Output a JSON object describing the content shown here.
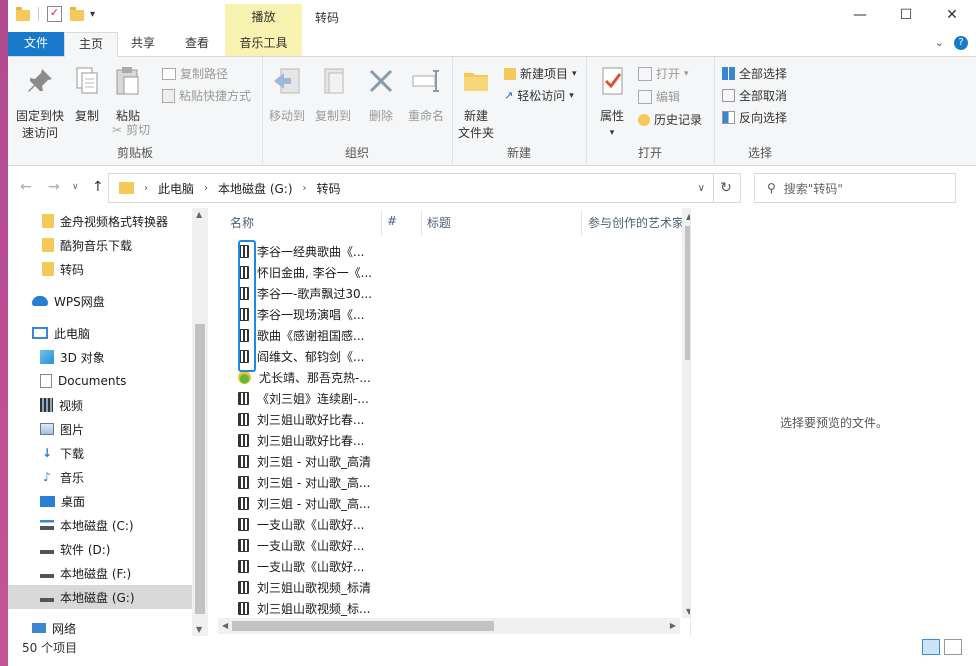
{
  "window": {
    "title": "转码",
    "context_tab": "播放",
    "qat_dropdown": "▾"
  },
  "tabs": [
    {
      "label": "文件"
    },
    {
      "label": "主页"
    },
    {
      "label": "共享"
    },
    {
      "label": "查看"
    },
    {
      "label": "音乐工具"
    }
  ],
  "ribbon": {
    "clipboard": {
      "group_label": "剪贴板",
      "pin_label_1": "固定到快",
      "pin_label_2": "速访问",
      "copy_label": "复制",
      "paste_label": "粘贴",
      "copy_path_label": "复制路径",
      "paste_shortcut_label": "粘贴快捷方式",
      "cut_label": "剪切"
    },
    "organize": {
      "group_label": "组织",
      "move_to_label": "移动到",
      "copy_to_label": "复制到",
      "delete_label": "删除",
      "rename_label": "重命名"
    },
    "new": {
      "group_label": "新建",
      "new_folder_label_1": "新建",
      "new_folder_label_2": "文件夹",
      "new_item_label": "新建项目",
      "easy_access_label": "轻松访问"
    },
    "open": {
      "group_label": "打开",
      "properties_label": "属性",
      "open_label": "打开",
      "edit_label": "编辑",
      "history_label": "历史记录"
    },
    "select": {
      "group_label": "选择",
      "select_all_label": "全部选择",
      "select_none_label": "全部取消",
      "invert_label": "反向选择"
    }
  },
  "address": {
    "crumbs": [
      "此电脑",
      "本地磁盘 (G:)",
      "转码"
    ],
    "search_placeholder": "搜索\"转码\""
  },
  "nav": {
    "items": [
      {
        "label": "金舟视频格式转换器",
        "icon": "folder-icon"
      },
      {
        "label": "酷狗音乐下载",
        "icon": "folder-icon"
      },
      {
        "label": "转码",
        "icon": "folder-icon"
      },
      {
        "label": "WPS网盘",
        "icon": "cloud-icon"
      },
      {
        "label": "此电脑",
        "icon": "computer-icon"
      },
      {
        "label": "3D 对象",
        "icon": "cube-icon"
      },
      {
        "label": "Documents",
        "icon": "document-icon"
      },
      {
        "label": "视频",
        "icon": "video-icon"
      },
      {
        "label": "图片",
        "icon": "picture-icon"
      },
      {
        "label": "下载",
        "icon": "download-icon"
      },
      {
        "label": "音乐",
        "icon": "music-icon"
      },
      {
        "label": "桌面",
        "icon": "desktop-icon"
      },
      {
        "label": "本地磁盘 (C:)",
        "icon": "drive-icon"
      },
      {
        "label": "软件 (D:)",
        "icon": "drive-icon"
      },
      {
        "label": "本地磁盘 (F:)",
        "icon": "drive-icon"
      },
      {
        "label": "本地磁盘 (G:)",
        "icon": "drive-icon"
      },
      {
        "label": "网络",
        "icon": "network-icon"
      }
    ]
  },
  "list": {
    "columns": [
      "名称",
      "#",
      "标题",
      "参与创作的艺术家"
    ],
    "files": [
      {
        "name": "李谷一经典歌曲《...",
        "icon": "video-file-icon"
      },
      {
        "name": "怀旧金曲, 李谷一《...",
        "icon": "video-file-icon"
      },
      {
        "name": "李谷一-歌声飘过30...",
        "icon": "video-file-icon"
      },
      {
        "name": "李谷一现场演唱《...",
        "icon": "video-file-icon"
      },
      {
        "name": "歌曲《感谢祖国感...",
        "icon": "video-file-icon"
      },
      {
        "name": "阎维文、郁钧剑《...",
        "icon": "video-file-icon"
      },
      {
        "name": "尤长靖、那吾克热-...",
        "icon": "music-file-icon"
      },
      {
        "name": "《刘三姐》连续剧-...",
        "icon": "video-file-icon"
      },
      {
        "name": "刘三姐山歌好比春...",
        "icon": "video-file-icon"
      },
      {
        "name": "刘三姐山歌好比春...",
        "icon": "video-file-icon"
      },
      {
        "name": "刘三姐 - 对山歌_高清",
        "icon": "video-file-icon"
      },
      {
        "name": "刘三姐 - 对山歌_高...",
        "icon": "video-file-icon"
      },
      {
        "name": "刘三姐 - 对山歌_高...",
        "icon": "video-file-icon"
      },
      {
        "name": "一支山歌《山歌好...",
        "icon": "video-file-icon"
      },
      {
        "name": "一支山歌《山歌好...",
        "icon": "video-file-icon"
      },
      {
        "name": "一支山歌《山歌好...",
        "icon": "video-file-icon"
      },
      {
        "name": "刘三姐山歌视频_标清",
        "icon": "video-file-icon"
      },
      {
        "name": "刘三姐山歌视频_标...",
        "icon": "video-file-icon"
      }
    ]
  },
  "preview": {
    "message": "选择要预览的文件。"
  },
  "status": {
    "item_count": "50 个项目"
  },
  "colors": {
    "accent": "#1979ca",
    "context_tab": "#f8f3b0",
    "selection_outline": "#1e88e5"
  }
}
